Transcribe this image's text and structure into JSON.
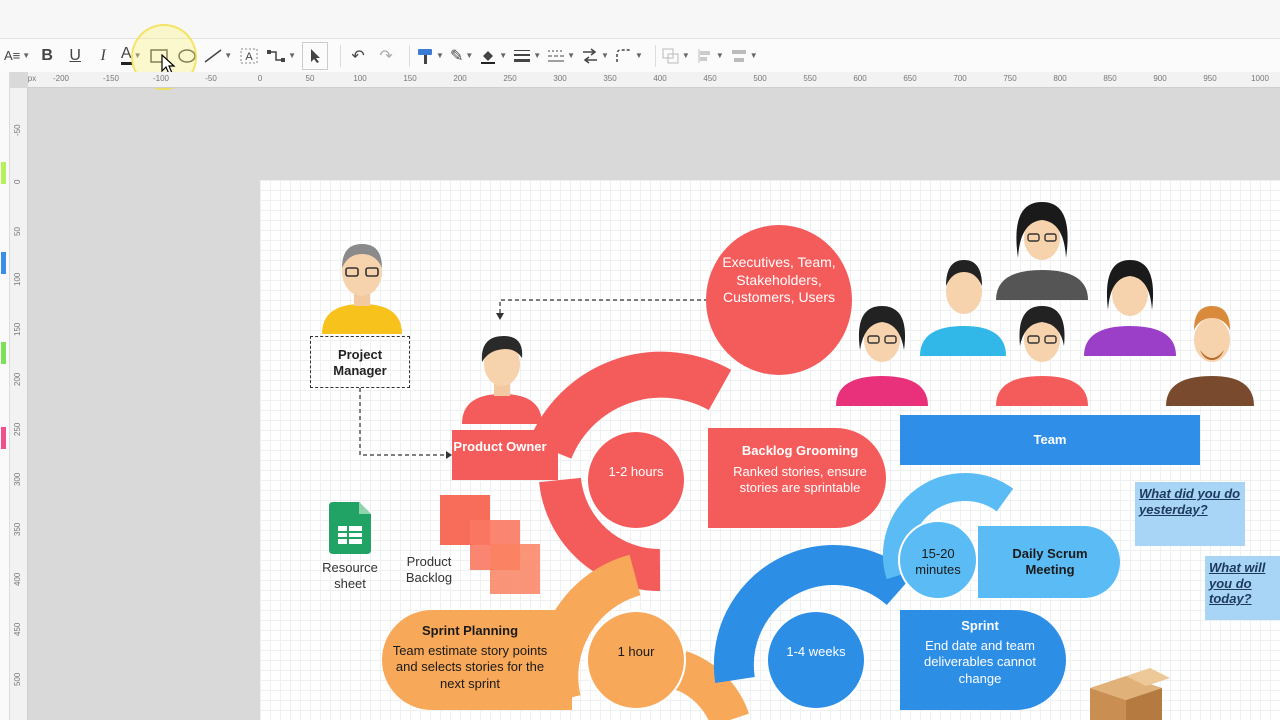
{
  "toolbar": {
    "text_align": "A≡",
    "bold": "B",
    "underline": "U",
    "italic": "I",
    "font_color": "A",
    "items": [
      "rectangle-icon",
      "ellipse-icon",
      "line-icon",
      "text-icon",
      "connector-icon",
      "select-icon",
      "undo-icon",
      "redo-icon",
      "format-painter-icon",
      "line-color-icon",
      "fill-color-icon",
      "line-weight-icon",
      "line-style-icon",
      "arrange-icon",
      "corner-icon",
      "group-icon",
      "align-icon",
      "distribute-icon"
    ]
  },
  "ruler": {
    "unit": "px",
    "top_ticks": [
      "-200",
      "-150",
      "-100",
      "-50",
      "0",
      "50",
      "100",
      "150",
      "200",
      "250",
      "300",
      "350",
      "400",
      "450",
      "500",
      "550",
      "600",
      "650",
      "700",
      "750",
      "800",
      "850",
      "900",
      "950",
      "1000"
    ],
    "left_ticks": [
      "-50",
      "0",
      "50",
      "100",
      "150",
      "200",
      "250",
      "300",
      "350",
      "400",
      "450",
      "500"
    ]
  },
  "diagram": {
    "project_manager": "Project Manager",
    "stakeholders": "Executives, Team, Stakeholders, Customers, Users",
    "product_owner": "Product Owner",
    "backlog_grooming_title": "Backlog Grooming",
    "backlog_grooming_desc": "Ranked stories, ensure stories are sprintable",
    "backlog_hours": "1-2 hours",
    "team": "Team",
    "resource_sheet": "Resource sheet",
    "product_backlog": "Product Backlog",
    "daily_scrum_time": "15-20 minutes",
    "daily_scrum": "Daily Scrum Meeting",
    "sprint_planning_title": "Sprint Planning",
    "sprint_planning_desc": "Team estimate story points and selects stories for the next sprint",
    "sprint_planning_time": "1 hour",
    "sprint_weeks": "1-4 weeks",
    "sprint_title": "Sprint",
    "sprint_desc": "End date and team deliverables cannot change",
    "note_yesterday": "What did you do yesterday?",
    "note_today": "What will you do today?"
  },
  "colors": {
    "red": "#f45b5b",
    "blue": "#2d8ee6",
    "light_blue": "#5bbcf5",
    "orange": "#f7a858",
    "team_bar": "#2f8fe8"
  }
}
